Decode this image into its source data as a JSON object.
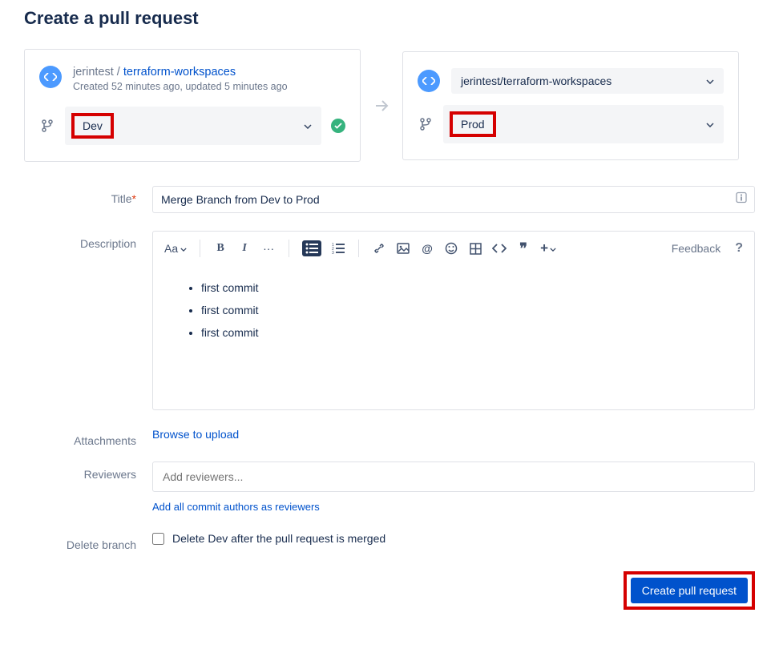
{
  "page": {
    "title": "Create a pull request"
  },
  "source": {
    "owner": "jerintest",
    "repo_link": "terraform-workspaces",
    "meta": "Created 52 minutes ago, updated 5 minutes ago",
    "branch": "Dev"
  },
  "arrow": "→",
  "dest": {
    "repo": "jerintest/terraform-workspaces",
    "branch": "Prod"
  },
  "form": {
    "title_label": "Title",
    "title_value": "Merge Branch from Dev to Prod",
    "description_label": "Description",
    "description_items": [
      "first commit",
      "first commit",
      "first commit"
    ],
    "attachments_label": "Attachments",
    "browse_label": "Browse to upload",
    "reviewers_label": "Reviewers",
    "reviewers_placeholder": "Add reviewers...",
    "add_all_label": "Add all commit authors as reviewers",
    "delete_branch_label": "Delete branch",
    "delete_checkbox_label": "Delete Dev after the pull request is merged",
    "submit_label": "Create pull request"
  },
  "toolbar": {
    "text_style": "Aa",
    "feedback": "Feedback",
    "help": "?",
    "ellipsis": "···",
    "quote": "❞",
    "plus": "+"
  }
}
